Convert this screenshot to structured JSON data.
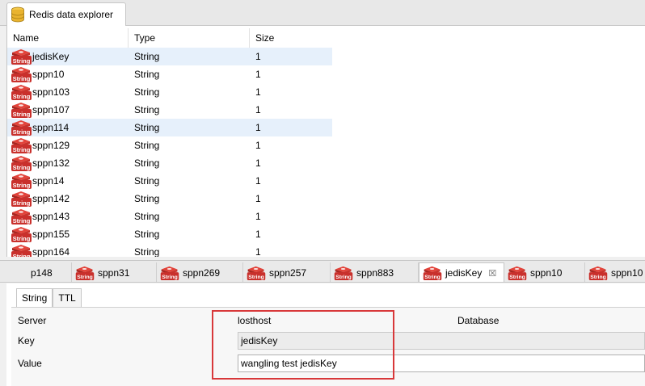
{
  "view_tab": {
    "title": "Redis data explorer",
    "icon": "database-icon"
  },
  "table": {
    "columns": [
      "Name",
      "Type",
      "Size"
    ],
    "rows": [
      {
        "name": "jedisKey",
        "type": "String",
        "size": "1",
        "selected": true
      },
      {
        "name": "sppn10",
        "type": "String",
        "size": "1"
      },
      {
        "name": "sppn103",
        "type": "String",
        "size": "1"
      },
      {
        "name": "sppn107",
        "type": "String",
        "size": "1"
      },
      {
        "name": "sppn114",
        "type": "String",
        "size": "1",
        "selected": true
      },
      {
        "name": "sppn129",
        "type": "String",
        "size": "1"
      },
      {
        "name": "sppn132",
        "type": "String",
        "size": "1"
      },
      {
        "name": "sppn14",
        "type": "String",
        "size": "1"
      },
      {
        "name": "sppn142",
        "type": "String",
        "size": "1"
      },
      {
        "name": "sppn143",
        "type": "String",
        "size": "1"
      },
      {
        "name": "sppn155",
        "type": "String",
        "size": "1"
      },
      {
        "name": "sppn164",
        "type": "String",
        "size": "1"
      }
    ]
  },
  "icon_text": "String",
  "editor_tabs": [
    {
      "label": "p148"
    },
    {
      "label": "sppn31"
    },
    {
      "label": "sppn269"
    },
    {
      "label": "sppn257"
    },
    {
      "label": "sppn883"
    },
    {
      "label": "jedisKey",
      "active": true,
      "close": "☒"
    },
    {
      "label": "sppn10"
    },
    {
      "label": "sppn10"
    }
  ],
  "inner_tabs": [
    "String",
    "TTL"
  ],
  "form": {
    "server_label": "Server",
    "server_value": "losthost",
    "database_label": "Database",
    "key_label": "Key",
    "key_value": "jedisKey",
    "value_label": "Value",
    "value_value": "wangling test jedisKey"
  },
  "colors": {
    "selection": "#e6f0fb",
    "highlight": "#d8383a",
    "redis_red": "#c9302c"
  }
}
